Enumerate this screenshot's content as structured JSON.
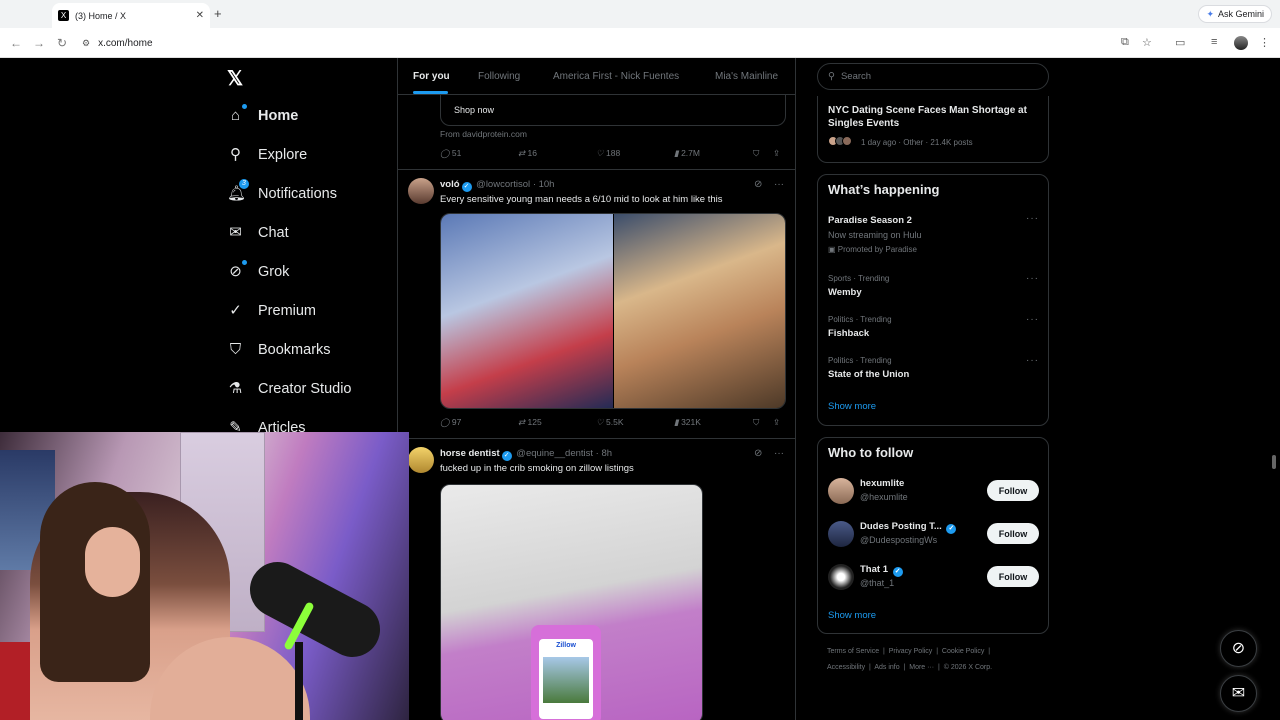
{
  "browser": {
    "tab_title": "(3) Home / X",
    "tab_favicon": "X",
    "new_tab": "+",
    "close": "✕",
    "gemini_label": "Ask Gemini",
    "url": "x.com/home"
  },
  "nav": {
    "logo": "𝕏",
    "items": [
      {
        "label": "Home"
      },
      {
        "label": "Explore"
      },
      {
        "label": "Notifications",
        "badge": "3"
      },
      {
        "label": "Chat"
      },
      {
        "label": "Grok"
      },
      {
        "label": "Premium"
      },
      {
        "label": "Bookmarks"
      },
      {
        "label": "Creator Studio"
      },
      {
        "label": "Articles"
      }
    ]
  },
  "timeline": {
    "tabs": [
      "For you",
      "Following",
      "America First - Nick Fuentes",
      "Mia's Mainline"
    ],
    "ad": {
      "shop_label": "Shop now",
      "from": "From davidprotein.com",
      "replies": "51",
      "reposts": "16",
      "likes": "188",
      "views": "2.7M"
    },
    "posts": [
      {
        "name": "voló",
        "handle": "@lowcortisol",
        "time": "· 10h",
        "text": "Every sensitive young man needs a 6/10 mid to look at him like this",
        "replies": "97",
        "reposts": "125",
        "likes": "5.5K",
        "views": "321K"
      },
      {
        "name": "horse dentist",
        "handle": "@equine__dentist",
        "time": "· 8h",
        "text": "fucked up in the crib smoking on zillow listings",
        "image_text": "Zillow"
      }
    ]
  },
  "right": {
    "search_placeholder": "Search",
    "news": {
      "title": "NYC Dating Scene Faces Man Shortage at Singles Events",
      "meta": "1 day ago · Other · 21.4K posts"
    },
    "whats_happening": {
      "title": "What’s happening",
      "promoted": {
        "name": "Paradise Season 2",
        "sub": "Now streaming on Hulu",
        "promoted_by": "Promoted by Paradise"
      },
      "trends": [
        {
          "category": "Sports · Trending",
          "name": "Wemby"
        },
        {
          "category": "Politics · Trending",
          "name": "Fishback"
        },
        {
          "category": "Politics · Trending",
          "name": "State of the Union"
        }
      ],
      "show_more": "Show more"
    },
    "who_to_follow": {
      "title": "Who to follow",
      "users": [
        {
          "name": "hexumlite",
          "handle": "@hexumlite"
        },
        {
          "name": "Dudes Posting T...",
          "handle": "@DudespostingWs"
        },
        {
          "name": "That 1",
          "handle": "@that_1"
        }
      ],
      "follow_label": "Follow",
      "show_more": "Show more"
    },
    "footer": {
      "line1": [
        "Terms of Service",
        "Privacy Policy",
        "Cookie Policy"
      ],
      "line2": [
        "Accessibility",
        "Ads info",
        "More ···",
        "© 2026 X Corp."
      ]
    }
  },
  "colors": {
    "accent": "#1d9bf0",
    "bg": "#000000",
    "border": "#2f3336",
    "muted": "#71767b"
  }
}
